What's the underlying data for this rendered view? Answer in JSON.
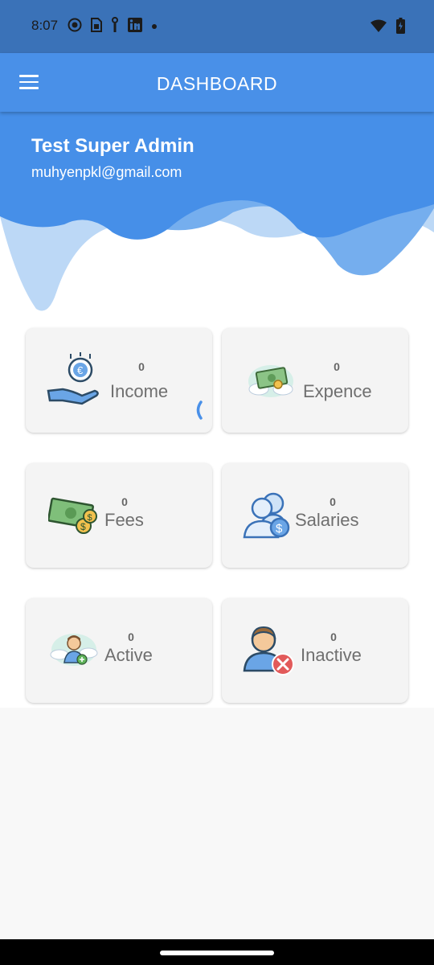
{
  "status_bar": {
    "time": "8:07",
    "left_icons": [
      "github-icon",
      "sim-icon",
      "info-icon",
      "linkedin-icon",
      "dot-icon"
    ],
    "right_icons": [
      "wifi-icon",
      "battery-icon"
    ]
  },
  "app_bar": {
    "title": "DASHBOARD",
    "menu_icon": "hamburger-menu-icon"
  },
  "user": {
    "name": "Test Super Admin",
    "email": "muhyenpkl@gmail.com"
  },
  "cards": [
    {
      "key": "income",
      "count": "0",
      "label": "Income",
      "icon": "money-hand-icon"
    },
    {
      "key": "expence",
      "count": "0",
      "label": "Expence",
      "icon": "cash-cloud-icon"
    },
    {
      "key": "fees",
      "count": "0",
      "label": "Fees",
      "icon": "banknote-coins-icon"
    },
    {
      "key": "salaries",
      "count": "0",
      "label": "Salaries",
      "icon": "users-dollar-icon"
    },
    {
      "key": "active",
      "count": "0",
      "label": "Active",
      "icon": "person-cloud-add-icon"
    },
    {
      "key": "inactive",
      "count": "0",
      "label": "Inactive",
      "icon": "person-remove-icon"
    }
  ],
  "colors": {
    "status_bar": "#3a72b8",
    "app_bar": "#4990e8",
    "card_bg": "#f4f4f4",
    "label": "#6f6f6f"
  }
}
